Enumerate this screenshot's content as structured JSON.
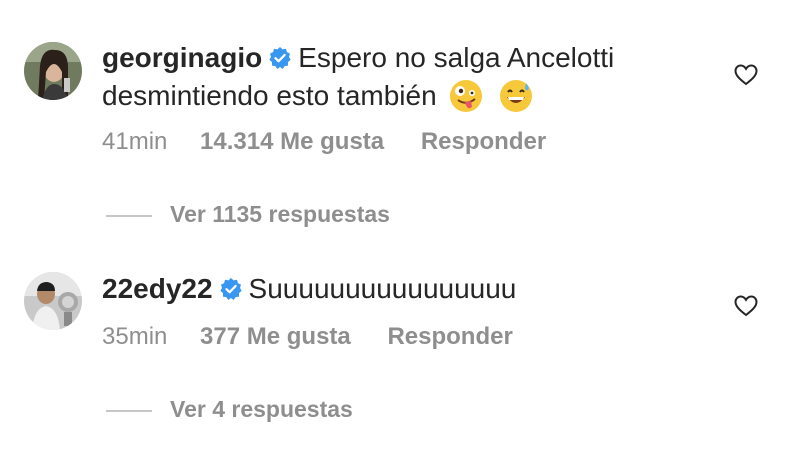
{
  "comments": [
    {
      "username": "georginagio",
      "verified": true,
      "text_line1": "Espero no salga Ancelotti",
      "text_line2": "desmintiendo esto también",
      "emojis": [
        "zany-face-emoji",
        "grinning-sweat-emoji"
      ],
      "time": "41min",
      "likes": "14.314 Me gusta",
      "reply_label": "Responder",
      "view_replies": "Ver 1135 respuestas"
    },
    {
      "username": "22edy22",
      "verified": true,
      "text_line1": "Suuuuuuuuuuuuuuuu",
      "time": "35min",
      "likes": "377 Me gusta",
      "reply_label": "Responder",
      "view_replies": "Ver 4 respuestas"
    }
  ],
  "icons": {
    "verified": "verified-badge-icon",
    "like": "heart-outline-icon"
  },
  "colors": {
    "text": "#262626",
    "secondary": "#8e8e8e",
    "verified": "#3897f0"
  }
}
